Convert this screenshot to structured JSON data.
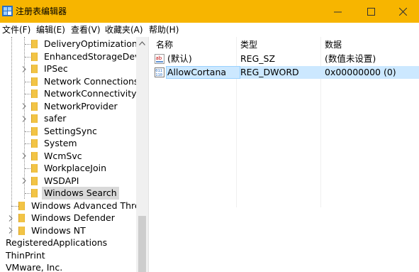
{
  "window": {
    "title": "注册表编辑器",
    "minimize_glyph": "—",
    "maximize_glyph": "☐",
    "close_glyph": "✕"
  },
  "menu": [
    "文件(F)",
    "编辑(E)",
    "查看(V)",
    "收藏夹(A)",
    "帮助(H)"
  ],
  "tree": {
    "nodes": [
      {
        "label": "DeliveryOptimization",
        "expandable": false
      },
      {
        "label": "EnhancedStorageDevic",
        "expandable": false
      },
      {
        "label": "IPSec",
        "expandable": true
      },
      {
        "label": "Network Connections",
        "expandable": false
      },
      {
        "label": "NetworkConnectivityS",
        "expandable": false
      },
      {
        "label": "NetworkProvider",
        "expandable": true
      },
      {
        "label": "safer",
        "expandable": true
      },
      {
        "label": "SettingSync",
        "expandable": false
      },
      {
        "label": "System",
        "expandable": false
      },
      {
        "label": "WcmSvc",
        "expandable": true
      },
      {
        "label": "WorkplaceJoin",
        "expandable": false
      },
      {
        "label": "WSDAPI",
        "expandable": true
      },
      {
        "label": "Windows Search",
        "expandable": false,
        "selected": true
      },
      {
        "label": "Windows Advanced Threa",
        "expandable": false
      },
      {
        "label": "Windows Defender",
        "expandable": true
      },
      {
        "label": "Windows NT",
        "expandable": true
      },
      {
        "label": "RegisteredApplications",
        "expandable": false
      },
      {
        "label": "ThinPrint",
        "expandable": false
      },
      {
        "label": "VMware, Inc.",
        "expandable": false
      }
    ]
  },
  "values_list": {
    "columns": {
      "name": "名称",
      "type": "类型",
      "data": "数据"
    },
    "rows": [
      {
        "icon": "string-value-icon",
        "name": "(默认)",
        "type": "REG_SZ",
        "data": "(数值未设置)",
        "selected": false
      },
      {
        "icon": "binary-value-icon",
        "name": "AllowCortana",
        "type": "REG_DWORD",
        "data": "0x00000000 (0)",
        "selected": true
      }
    ]
  },
  "colors": {
    "title_bar": "#f7b500",
    "selection": "#cce8ff",
    "folder": "#f2c446"
  }
}
